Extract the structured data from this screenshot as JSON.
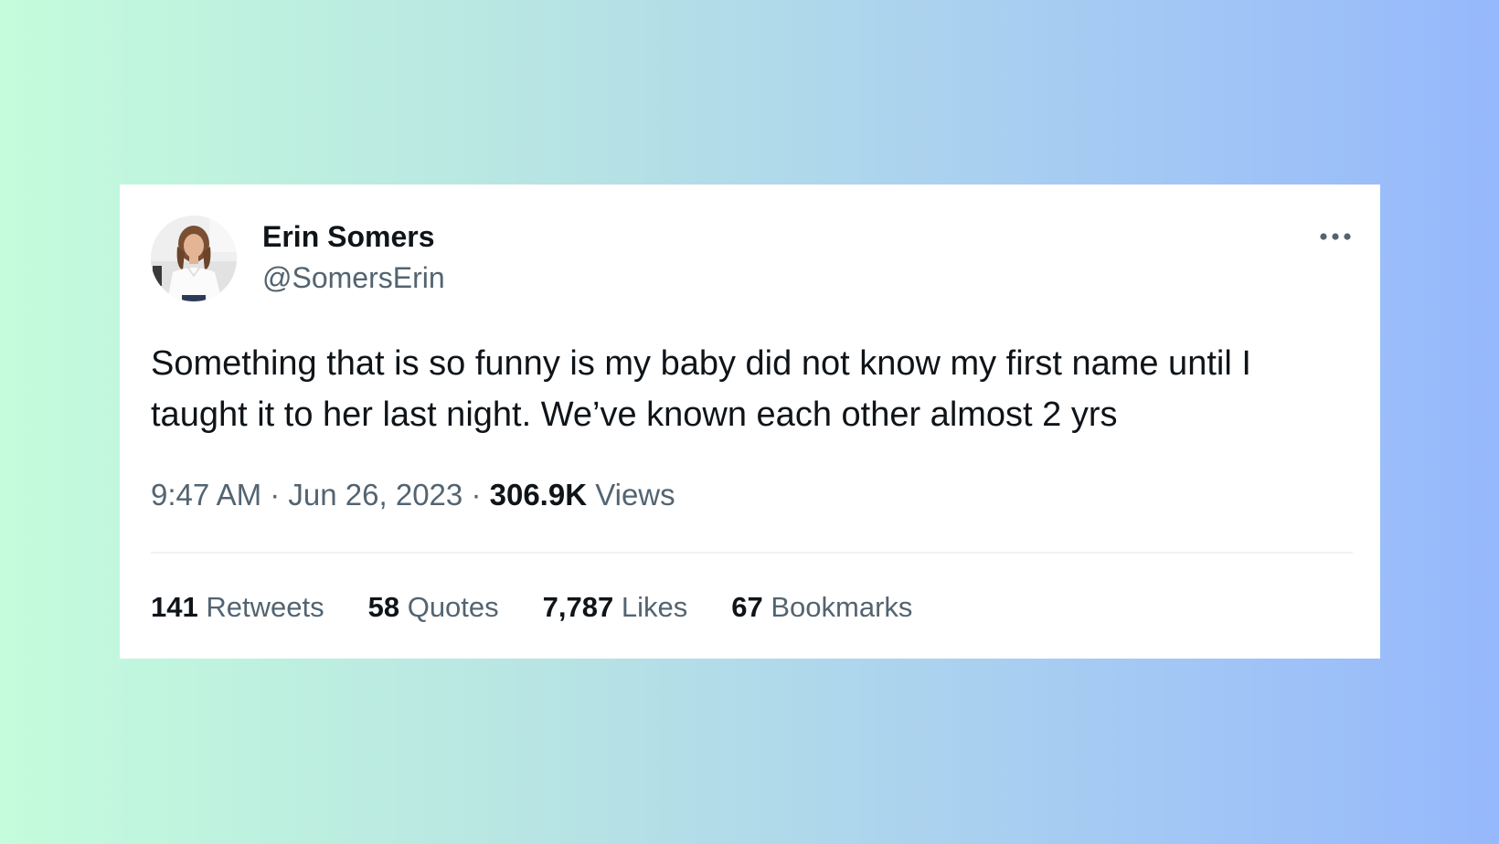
{
  "tweet": {
    "author": {
      "display_name": "Erin Somers",
      "handle": "@SomersErin"
    },
    "text": "Something that is so funny is my baby did not know my first name until I taught it to her last night. We’ve known each other almost 2 yrs",
    "time": "9:47 AM",
    "date": "Jun 26, 2023",
    "separator": "·",
    "views_count": "306.9K",
    "views_label": "Views",
    "more_icon": "more-horizontal-icon",
    "stats": [
      {
        "count": "141",
        "label": "Retweets"
      },
      {
        "count": "58",
        "label": "Quotes"
      },
      {
        "count": "7,787",
        "label": "Likes"
      },
      {
        "count": "67",
        "label": "Bookmarks"
      }
    ]
  },
  "colors": {
    "text_primary": "#0f1419",
    "text_secondary": "#536471",
    "divider": "#eff3f4",
    "gradient_start": "#c4fcdc",
    "gradient_end": "#96b8fc"
  }
}
